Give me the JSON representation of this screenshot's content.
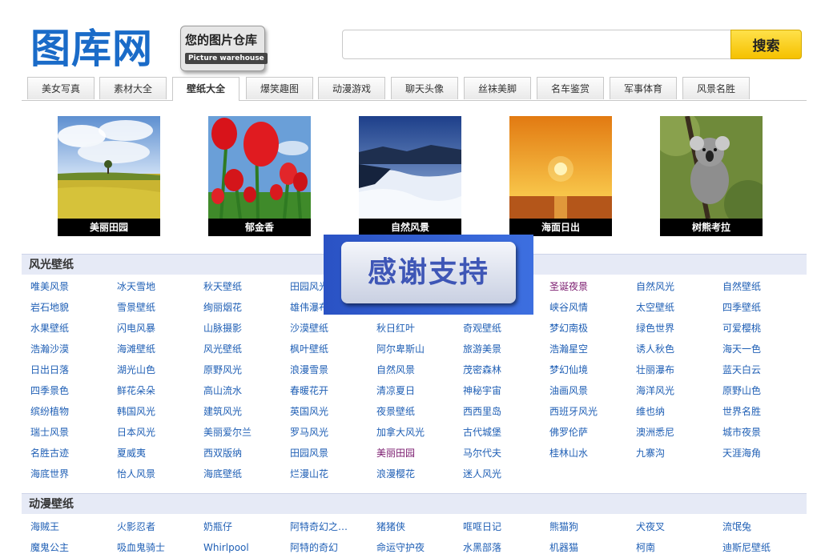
{
  "logo": {
    "main": "图库网",
    "tagline": "您的图片仓库",
    "sub": "Picture warehouse"
  },
  "search": {
    "value": "",
    "placeholder": "",
    "button": "搜索"
  },
  "tabs": [
    "美女写真",
    "素材大全",
    "壁纸大全",
    "爆笑趣图",
    "动漫游戏",
    "聊天头像",
    "丝袜美脚",
    "名车鉴赏",
    "军事体育",
    "风景名胜"
  ],
  "active_tab": "壁纸大全",
  "featured": [
    {
      "caption": "美丽田园",
      "image": "field-photo"
    },
    {
      "caption": "郁金香",
      "image": "tulip-photo"
    },
    {
      "caption": "自然风景",
      "image": "cloud-sea-photo"
    },
    {
      "caption": "海面日出",
      "image": "sunrise-photo"
    },
    {
      "caption": "树熊考拉",
      "image": "koala-photo"
    }
  ],
  "sections": [
    {
      "title": "风光壁纸",
      "rows": [
        [
          "唯美风景",
          "冰天雪地",
          "秋天壁纸",
          "田园风光",
          "",
          "",
          "圣诞夜景",
          "自然风光",
          "自然壁纸"
        ],
        [
          "岩石地貌",
          "雪景壁纸",
          "绚丽烟花",
          "雄伟瀑布",
          "",
          "",
          "峡谷风情",
          "太空壁纸",
          "四季壁纸"
        ],
        [
          "水果壁纸",
          "闪电风暴",
          "山脉摄影",
          "沙漠壁纸",
          "秋日红叶",
          "奇观壁纸",
          "梦幻南极",
          "绿色世界",
          "可爱樱桃"
        ],
        [
          "浩瀚沙漠",
          "海滩壁纸",
          "风光壁纸",
          "枫叶壁纸",
          "阿尔卑斯山",
          "旅游美景",
          "浩瀚星空",
          "诱人秋色",
          "海天一色"
        ],
        [
          "日出日落",
          "湖光山色",
          "原野风光",
          "浪漫雪景",
          "自然风景",
          "茂密森林",
          "梦幻仙境",
          "壮丽瀑布",
          "蓝天白云"
        ],
        [
          "四季景色",
          "鲜花朵朵",
          "高山流水",
          "春暖花开",
          "清凉夏日",
          "神秘宇宙",
          "油画风景",
          "海洋风光",
          "原野山色"
        ],
        [
          "缤纷植物",
          "韩国风光",
          "建筑风光",
          "英国风光",
          "夜景壁纸",
          "西西里岛",
          "西班牙风光",
          "维也纳",
          "世界名胜"
        ],
        [
          "瑞士风景",
          "日本风光",
          "美丽爱尔兰",
          "罗马风光",
          "加拿大风光",
          "古代城堡",
          "佛罗伦萨",
          "澳洲悉尼",
          "城市夜景"
        ],
        [
          "名胜古迹",
          "夏威夷",
          "西双版纳",
          "田园风景",
          "美丽田园",
          "马尔代夫",
          "桂林山水",
          "九寨沟",
          "天涯海角"
        ],
        [
          "海底世界",
          "怡人风景",
          "海底壁纸",
          "烂漫山花",
          "浪漫樱花",
          "迷人风光",
          "",
          "",
          ""
        ]
      ],
      "visited": [
        "圣诞夜景",
        "美丽田园"
      ]
    },
    {
      "title": "动漫壁纸",
      "rows": [
        [
          "海贼王",
          "火影忍者",
          "奶瓶仔",
          "阿特奇幻之…",
          "猪猪侠",
          "哐哐日记",
          "熊猫狗",
          "犬夜叉",
          "流氓兔"
        ]
      ],
      "visited": []
    }
  ],
  "partial_row": [
    "魔鬼公主",
    "吸血鬼骑士",
    "Whirlpool",
    "阿特的奇幻",
    "命运守护夜",
    "水黑部落",
    "机器猫",
    "柯南",
    "迪斯尼壁纸"
  ],
  "overlay": {
    "text": "感谢支持"
  },
  "colors": {
    "link": "#1f5fb5",
    "visited": "#7a1a6e",
    "logo": "#1a6bc8",
    "section_bg": "#e6eaf6",
    "button": "#f5c100"
  }
}
